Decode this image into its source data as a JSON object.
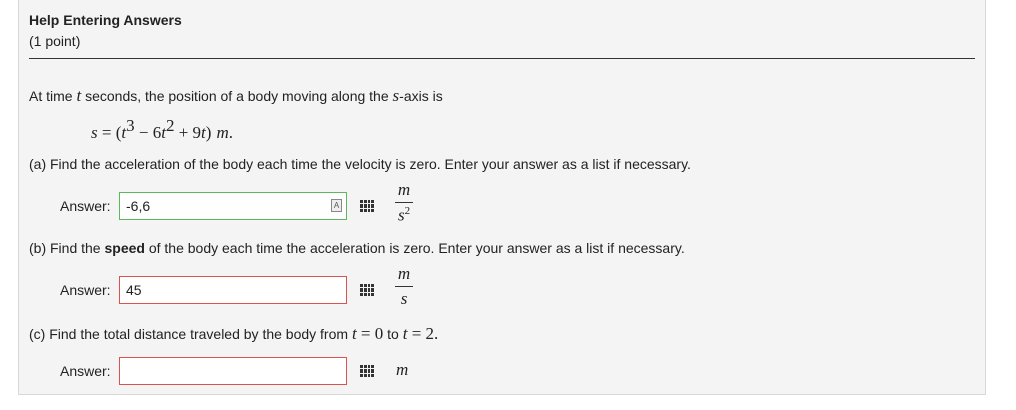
{
  "header": {
    "title": "Help Entering Answers",
    "points": "(1 point)"
  },
  "problem": {
    "intro_pre": "At time",
    "intro_var_t": "t",
    "intro_mid": "seconds, the position of a body moving along the",
    "intro_var_s": "s",
    "intro_post": "-axis is",
    "eq_lhs": "s",
    "eq_eq": " = (",
    "eq_t1": "t",
    "eq_exp1": "3",
    "eq_minus": " − 6",
    "eq_t2": "t",
    "eq_exp2": "2",
    "eq_plus": " + 9",
    "eq_t3": "t",
    "eq_close": ")",
    "eq_unit": "m",
    "eq_period": "."
  },
  "part_a": {
    "question": "(a) Find the acceleration of the body each time the velocity is zero. Enter your answer as a list if necessary.",
    "answer_label": "Answer:",
    "value": "-6,6",
    "unit_num": "m",
    "unit_den": "s",
    "unit_den_exp": "2"
  },
  "part_b": {
    "question_pre": "(b) Find the",
    "question_bold": "speed",
    "question_post": "of the body each time the acceleration is zero. Enter your answer as a list if necessary.",
    "answer_label": "Answer:",
    "value": "45",
    "unit_num": "m",
    "unit_den": "s"
  },
  "part_c": {
    "question_pre": "(c) Find the total distance traveled by the body from",
    "var1": "t",
    "eq1": " = 0",
    "to": "to",
    "var2": "t",
    "eq2": " = 2.",
    "answer_label": "Answer:",
    "value": "",
    "unit": "m"
  },
  "icons": {
    "preview": "A",
    "equation_editor": "grid-icon"
  },
  "colors": {
    "correct_border": "#5cb85c",
    "incorrect_border": "#d9534f"
  }
}
